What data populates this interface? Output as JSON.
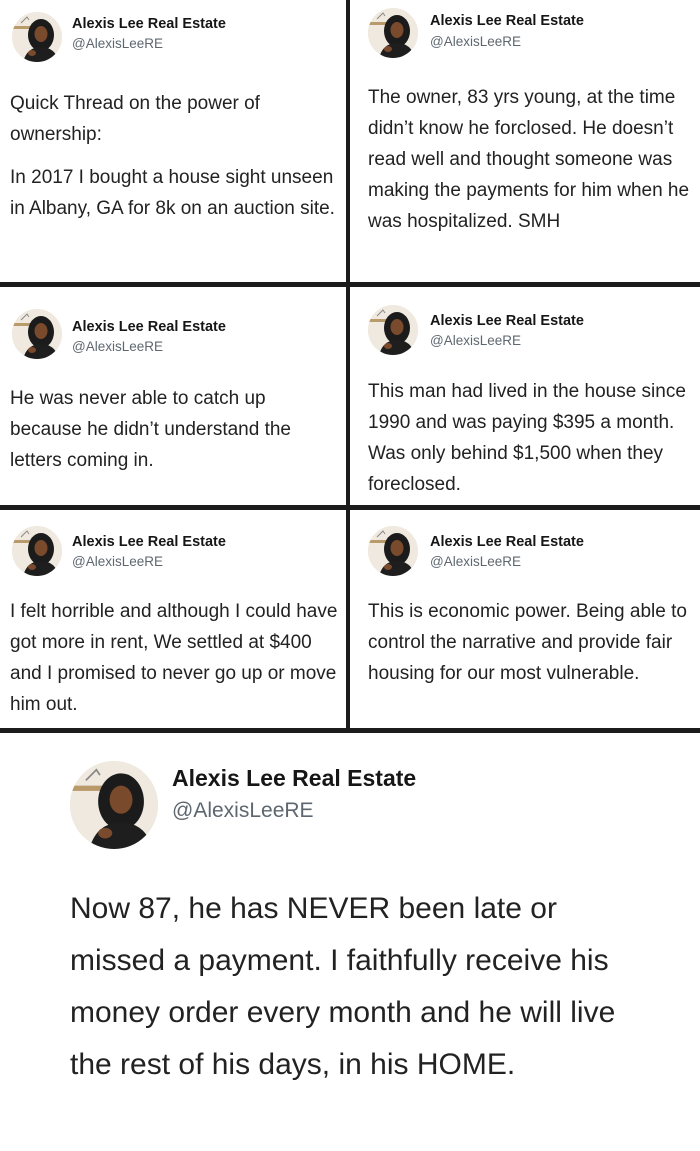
{
  "author": {
    "name": "Alexis Lee Real Estate",
    "handle": "@AlexisLeeRE"
  },
  "tweets": [
    {
      "paragraphs": [
        "Quick Thread on the power of ownership:",
        "In 2017 I bought a house sight unseen in Albany, GA for 8k on an auction site."
      ]
    },
    {
      "paragraphs": [
        "The owner, 83 yrs young, at the time didn’t know he forclosed. He doesn’t read well and thought someone was making the payments for him when he was hospitalized. SMH"
      ]
    },
    {
      "paragraphs": [
        "He was never able to catch up because he didn’t understand the letters coming in."
      ]
    },
    {
      "paragraphs": [
        "This man had lived in the house since 1990 and was paying $395 a month. Was only behind $1,500 when they foreclosed."
      ]
    },
    {
      "paragraphs": [
        "I felt horrible and although I could have got more in rent, We settled at $400 and I promised to never go up or move him out."
      ]
    },
    {
      "paragraphs": [
        "This is economic power. Being able to control the narrative and provide fair housing for our most vulnerable."
      ]
    },
    {
      "paragraphs": [
        "Now 87, he has NEVER been late or missed a payment. I faithfully receive his money order every month and he will live the rest of his days, in his HOME."
      ]
    }
  ]
}
